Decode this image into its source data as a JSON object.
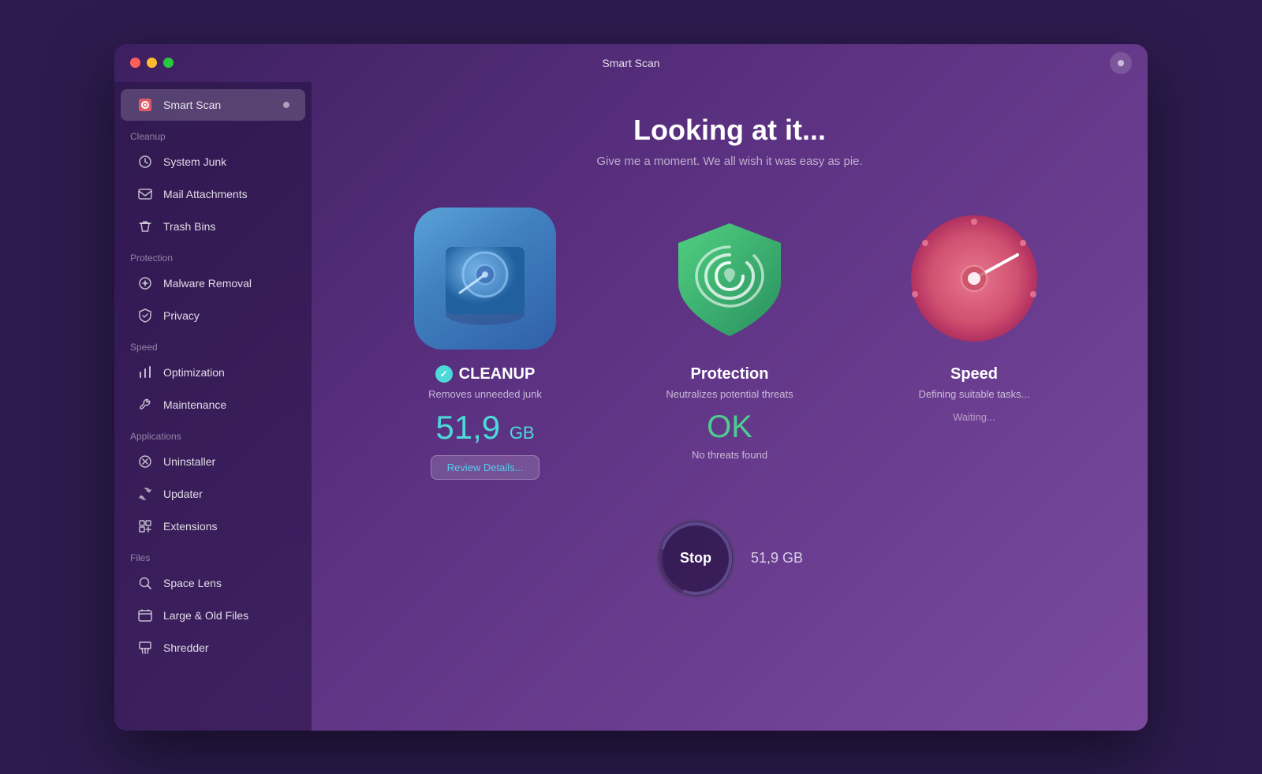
{
  "window": {
    "title": "Smart Scan"
  },
  "sidebar": {
    "active_item": "smart-scan",
    "top_item": {
      "label": "Smart Scan"
    },
    "sections": [
      {
        "label": "Cleanup",
        "items": [
          {
            "id": "system-junk",
            "label": "System Junk",
            "icon": "🗂"
          },
          {
            "id": "mail-attachments",
            "label": "Mail Attachments",
            "icon": "✉"
          },
          {
            "id": "trash-bins",
            "label": "Trash Bins",
            "icon": "🗑"
          }
        ]
      },
      {
        "label": "Protection",
        "items": [
          {
            "id": "malware-removal",
            "label": "Malware Removal",
            "icon": "☣"
          },
          {
            "id": "privacy",
            "label": "Privacy",
            "icon": "🖐"
          }
        ]
      },
      {
        "label": "Speed",
        "items": [
          {
            "id": "optimization",
            "label": "Optimization",
            "icon": "⚙"
          },
          {
            "id": "maintenance",
            "label": "Maintenance",
            "icon": "🔧"
          }
        ]
      },
      {
        "label": "Applications",
        "items": [
          {
            "id": "uninstaller",
            "label": "Uninstaller",
            "icon": "⊗"
          },
          {
            "id": "updater",
            "label": "Updater",
            "icon": "↑"
          },
          {
            "id": "extensions",
            "label": "Extensions",
            "icon": "⇌"
          }
        ]
      },
      {
        "label": "Files",
        "items": [
          {
            "id": "space-lens",
            "label": "Space Lens",
            "icon": "◎"
          },
          {
            "id": "large-old-files",
            "label": "Large & Old Files",
            "icon": "🗃"
          },
          {
            "id": "shredder",
            "label": "Shredder",
            "icon": "📄"
          }
        ]
      }
    ]
  },
  "main": {
    "title": "Looking at it...",
    "subtitle": "Give me a moment. We all wish it was easy as pie.",
    "cards": [
      {
        "id": "cleanup",
        "title": "CLEANUP",
        "has_check": true,
        "description": "Removes unneeded junk",
        "value": "51,9",
        "unit": "GB",
        "action_label": "Review Details..."
      },
      {
        "id": "protection",
        "title": "Protection",
        "has_check": false,
        "description": "Neutralizes potential threats",
        "ok_text": "OK",
        "no_threats": "No threats found"
      },
      {
        "id": "speed",
        "title": "Speed",
        "has_check": false,
        "description": "Defining suitable tasks...",
        "waiting": "Waiting..."
      }
    ],
    "stop_button": {
      "label": "Stop",
      "size_value": "51,9 GB"
    }
  },
  "colors": {
    "accent_cyan": "#4dd9d9",
    "accent_green": "#4dce90",
    "sidebar_bg": "rgba(40,20,70,0.6)",
    "window_gradient_start": "#3d2060",
    "window_gradient_end": "#7b4a9e"
  }
}
